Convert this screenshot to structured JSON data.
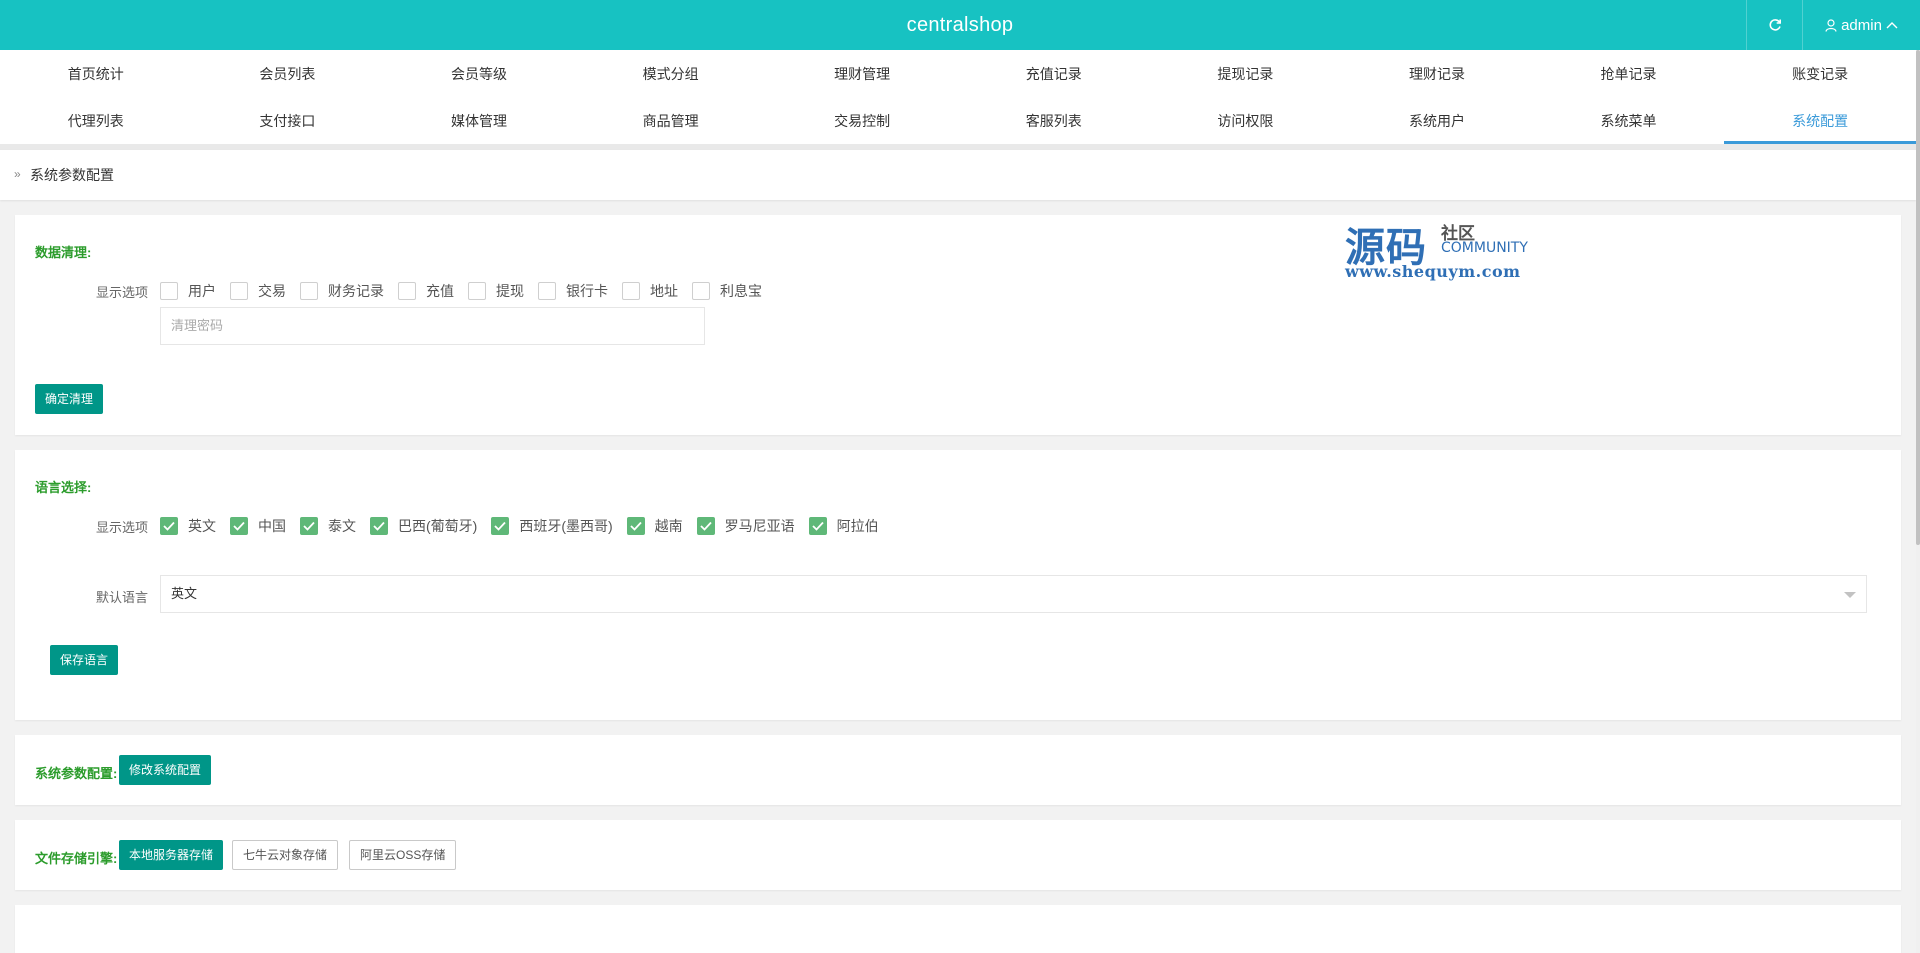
{
  "header": {
    "title": "centralshop",
    "refresh_icon": "refresh-icon",
    "user_icon": "user-icon",
    "username": "admin",
    "menu_icon": "chevron-up-icon",
    "brand_color": "#17c2c2"
  },
  "nav": {
    "row1": [
      "首页统计",
      "会员列表",
      "会员等级",
      "模式分组",
      "理财管理",
      "充值记录",
      "提现记录",
      "理财记录",
      "抢单记录",
      "账变记录"
    ],
    "row2": [
      "代理列表",
      "支付接口",
      "媒体管理",
      "商品管理",
      "交易控制",
      "客服列表",
      "访问权限",
      "系统用户",
      "系统菜单",
      "系统配置"
    ],
    "active": "系统配置",
    "active_color": "#3a9ad9"
  },
  "breadcrumb": {
    "icon": "double-chevron-right-icon",
    "text": "系统参数配置"
  },
  "data_clean": {
    "title": "数据清理:",
    "options_label": "显示选项",
    "options": [
      "用户",
      "交易",
      "财务记录",
      "充值",
      "提现",
      "银行卡",
      "地址",
      "利息宝"
    ],
    "checked": [
      false,
      false,
      false,
      false,
      false,
      false,
      false,
      false
    ],
    "password_placeholder": "清理密码",
    "confirm_button": "确定清理"
  },
  "language": {
    "title": "语言选择:",
    "options_label": "显示选项",
    "options": [
      "英文",
      "中国",
      "泰文",
      "巴西(葡萄牙)",
      "西班牙(墨西哥)",
      "越南",
      "罗马尼亚语",
      "阿拉伯"
    ],
    "checked": [
      true,
      true,
      true,
      true,
      true,
      true,
      true,
      true
    ],
    "default_label": "默认语言",
    "default_value": "英文",
    "save_button": "保存语言"
  },
  "sys_params": {
    "title": "系统参数配置:",
    "edit_button": "修改系统配置"
  },
  "storage": {
    "title": "文件存储引擎:",
    "engines": [
      "本地服务器存储",
      "七牛云对象存储",
      "阿里云OSS存储"
    ],
    "active": "本地服务器存储"
  },
  "watermark": {
    "main": "源码",
    "sub": "社区",
    "community": "COMMUNITY",
    "url": "www.shequym.com"
  },
  "colors": {
    "section_title": "#2c9c2c",
    "primary_button": "#009688",
    "checkbox_checked": "#5fb878"
  }
}
